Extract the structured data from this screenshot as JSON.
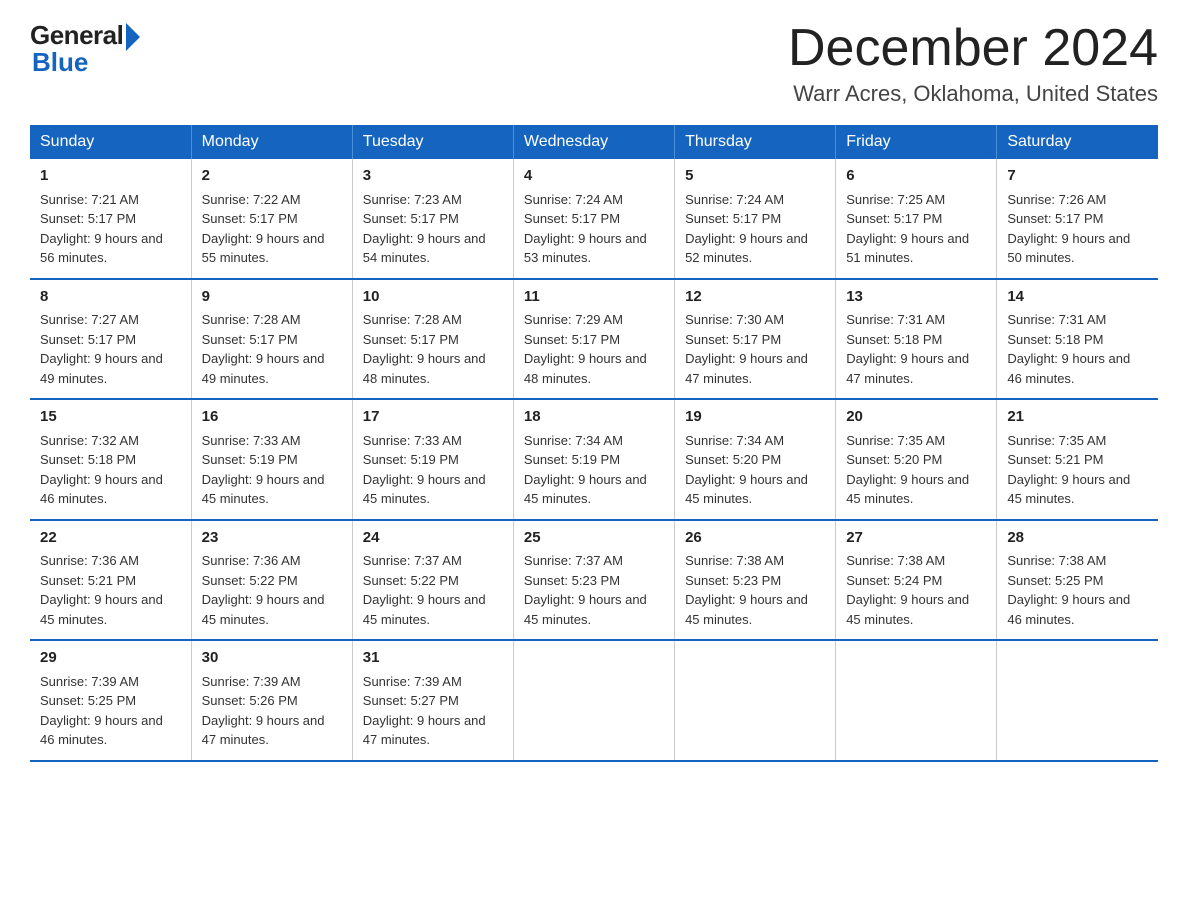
{
  "header": {
    "logo_general": "General",
    "logo_blue": "Blue",
    "title": "December 2024",
    "location": "Warr Acres, Oklahoma, United States"
  },
  "days_of_week": [
    "Sunday",
    "Monday",
    "Tuesday",
    "Wednesday",
    "Thursday",
    "Friday",
    "Saturday"
  ],
  "weeks": [
    [
      {
        "num": "1",
        "sunrise": "7:21 AM",
        "sunset": "5:17 PM",
        "daylight": "9 hours and 56 minutes."
      },
      {
        "num": "2",
        "sunrise": "7:22 AM",
        "sunset": "5:17 PM",
        "daylight": "9 hours and 55 minutes."
      },
      {
        "num": "3",
        "sunrise": "7:23 AM",
        "sunset": "5:17 PM",
        "daylight": "9 hours and 54 minutes."
      },
      {
        "num": "4",
        "sunrise": "7:24 AM",
        "sunset": "5:17 PM",
        "daylight": "9 hours and 53 minutes."
      },
      {
        "num": "5",
        "sunrise": "7:24 AM",
        "sunset": "5:17 PM",
        "daylight": "9 hours and 52 minutes."
      },
      {
        "num": "6",
        "sunrise": "7:25 AM",
        "sunset": "5:17 PM",
        "daylight": "9 hours and 51 minutes."
      },
      {
        "num": "7",
        "sunrise": "7:26 AM",
        "sunset": "5:17 PM",
        "daylight": "9 hours and 50 minutes."
      }
    ],
    [
      {
        "num": "8",
        "sunrise": "7:27 AM",
        "sunset": "5:17 PM",
        "daylight": "9 hours and 49 minutes."
      },
      {
        "num": "9",
        "sunrise": "7:28 AM",
        "sunset": "5:17 PM",
        "daylight": "9 hours and 49 minutes."
      },
      {
        "num": "10",
        "sunrise": "7:28 AM",
        "sunset": "5:17 PM",
        "daylight": "9 hours and 48 minutes."
      },
      {
        "num": "11",
        "sunrise": "7:29 AM",
        "sunset": "5:17 PM",
        "daylight": "9 hours and 48 minutes."
      },
      {
        "num": "12",
        "sunrise": "7:30 AM",
        "sunset": "5:17 PM",
        "daylight": "9 hours and 47 minutes."
      },
      {
        "num": "13",
        "sunrise": "7:31 AM",
        "sunset": "5:18 PM",
        "daylight": "9 hours and 47 minutes."
      },
      {
        "num": "14",
        "sunrise": "7:31 AM",
        "sunset": "5:18 PM",
        "daylight": "9 hours and 46 minutes."
      }
    ],
    [
      {
        "num": "15",
        "sunrise": "7:32 AM",
        "sunset": "5:18 PM",
        "daylight": "9 hours and 46 minutes."
      },
      {
        "num": "16",
        "sunrise": "7:33 AM",
        "sunset": "5:19 PM",
        "daylight": "9 hours and 45 minutes."
      },
      {
        "num": "17",
        "sunrise": "7:33 AM",
        "sunset": "5:19 PM",
        "daylight": "9 hours and 45 minutes."
      },
      {
        "num": "18",
        "sunrise": "7:34 AM",
        "sunset": "5:19 PM",
        "daylight": "9 hours and 45 minutes."
      },
      {
        "num": "19",
        "sunrise": "7:34 AM",
        "sunset": "5:20 PM",
        "daylight": "9 hours and 45 minutes."
      },
      {
        "num": "20",
        "sunrise": "7:35 AM",
        "sunset": "5:20 PM",
        "daylight": "9 hours and 45 minutes."
      },
      {
        "num": "21",
        "sunrise": "7:35 AM",
        "sunset": "5:21 PM",
        "daylight": "9 hours and 45 minutes."
      }
    ],
    [
      {
        "num": "22",
        "sunrise": "7:36 AM",
        "sunset": "5:21 PM",
        "daylight": "9 hours and 45 minutes."
      },
      {
        "num": "23",
        "sunrise": "7:36 AM",
        "sunset": "5:22 PM",
        "daylight": "9 hours and 45 minutes."
      },
      {
        "num": "24",
        "sunrise": "7:37 AM",
        "sunset": "5:22 PM",
        "daylight": "9 hours and 45 minutes."
      },
      {
        "num": "25",
        "sunrise": "7:37 AM",
        "sunset": "5:23 PM",
        "daylight": "9 hours and 45 minutes."
      },
      {
        "num": "26",
        "sunrise": "7:38 AM",
        "sunset": "5:23 PM",
        "daylight": "9 hours and 45 minutes."
      },
      {
        "num": "27",
        "sunrise": "7:38 AM",
        "sunset": "5:24 PM",
        "daylight": "9 hours and 45 minutes."
      },
      {
        "num": "28",
        "sunrise": "7:38 AM",
        "sunset": "5:25 PM",
        "daylight": "9 hours and 46 minutes."
      }
    ],
    [
      {
        "num": "29",
        "sunrise": "7:39 AM",
        "sunset": "5:25 PM",
        "daylight": "9 hours and 46 minutes."
      },
      {
        "num": "30",
        "sunrise": "7:39 AM",
        "sunset": "5:26 PM",
        "daylight": "9 hours and 47 minutes."
      },
      {
        "num": "31",
        "sunrise": "7:39 AM",
        "sunset": "5:27 PM",
        "daylight": "9 hours and 47 minutes."
      },
      {
        "num": "",
        "sunrise": "",
        "sunset": "",
        "daylight": ""
      },
      {
        "num": "",
        "sunrise": "",
        "sunset": "",
        "daylight": ""
      },
      {
        "num": "",
        "sunrise": "",
        "sunset": "",
        "daylight": ""
      },
      {
        "num": "",
        "sunrise": "",
        "sunset": "",
        "daylight": ""
      }
    ]
  ]
}
